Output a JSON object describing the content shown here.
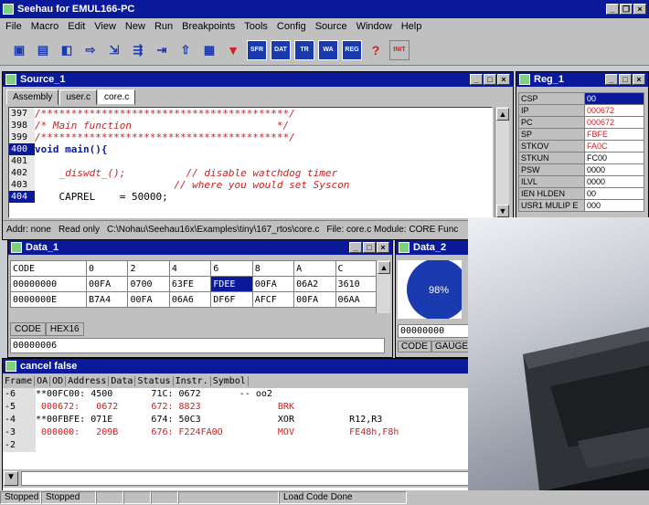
{
  "app": {
    "title": "Seehau for EMUL166-PC",
    "menu": [
      "File",
      "Macro",
      "Edit",
      "View",
      "New",
      "Run",
      "Breakpoints",
      "Tools",
      "Config",
      "Source",
      "Window",
      "Help"
    ]
  },
  "toolbar": {
    "buttons": [
      "open",
      "save",
      "find",
      "GO",
      "step-into",
      "step-over",
      "run-to",
      "reset",
      "break",
      "watch",
      "SFR",
      "DAT",
      "TR",
      "WA",
      "REG",
      "help",
      "INIT"
    ]
  },
  "source": {
    "title": "Source_1",
    "tabs": [
      "Assembly",
      "user.c",
      "core.c"
    ],
    "active_tab": "core.c",
    "lines": [
      {
        "n": "397",
        "code": "/*****************************************/",
        "style": "cmt"
      },
      {
        "n": "398",
        "code": "/* Main function                        */",
        "style": "cmt"
      },
      {
        "n": "399",
        "code": "/*****************************************/",
        "style": "cmt"
      },
      {
        "n": "400",
        "code": "void main(){",
        "style": "kw",
        "hl": true
      },
      {
        "n": "401",
        "code": "",
        "style": ""
      },
      {
        "n": "402",
        "code": "    _diswdt_();          // disable watchdog timer",
        "style": "cmt"
      },
      {
        "n": "403",
        "code": "                       // where you would set Syscon",
        "style": "cmt"
      },
      {
        "n": "404",
        "code": "    CAPREL    = 50000;",
        "style": "",
        "hl": true
      }
    ],
    "status": [
      "Addr: none",
      "Read only",
      "C:\\Nohau\\Seehau16x\\Examples\\tiny\\167_rtos\\core.c",
      "File: core.c Module: CORE Func"
    ]
  },
  "reg": {
    "title": "Reg_1",
    "rows": [
      {
        "name": "CSP",
        "value": "00",
        "sel": true
      },
      {
        "name": "IP",
        "value": "000672",
        "red": true
      },
      {
        "name": "PC",
        "value": "000672",
        "red": true
      },
      {
        "name": "SP",
        "value": "FBFE",
        "red": true
      },
      {
        "name": "STKOV",
        "value": "FA0C",
        "red": true
      },
      {
        "name": "STKUN",
        "value": "FC00"
      },
      {
        "name": "PSW",
        "value": "0000"
      },
      {
        "name": "   ILVL",
        "value": "0000"
      },
      {
        "name": "   IEN HLDEN",
        "value": "00"
      },
      {
        "name": "   USR1 MULIP E",
        "value": "000"
      }
    ]
  },
  "data1": {
    "title": "Data_1",
    "header": [
      "CODE",
      "0",
      "2",
      "4",
      "6",
      "8",
      "A",
      "C"
    ],
    "rows": [
      [
        "00000000",
        "00FA",
        "0700",
        "63FE",
        "FDEE",
        "00FA",
        "06A2",
        "3610"
      ],
      [
        "0000000E",
        "B7A4",
        "00FA",
        "06A6",
        "DF6F",
        "AFCF",
        "00FA",
        "06AA"
      ]
    ],
    "tabs": [
      "CODE",
      "HEX16"
    ],
    "input": "00000006"
  },
  "data2": {
    "title": "Data_2",
    "pie_label": "98%",
    "pie_value": 98,
    "input": "00000000",
    "tabs": [
      "CODE",
      "GAUGE"
    ]
  },
  "cancel": {
    "title": "cancel false",
    "headers": [
      "Frame",
      "OA",
      "OD",
      "Address",
      "Data",
      "Status",
      "Instr.",
      "Symbol"
    ],
    "rows": [
      {
        "frame": "-6",
        "text": "**00FC00: 4500       71C: 0672       -- oo2",
        "red": false
      },
      {
        "frame": "-5",
        "text": " 000672:   0672      672: 8823              BRK",
        "red": true
      },
      {
        "frame": "-4",
        "text": "**00FBFE: 071E       674: 50C3              XOR          R12,R3",
        "red": false
      },
      {
        "frame": "-3",
        "text": " 000000:   209B      676: F224FA0O          MOV          FE48h,F8h",
        "red": true
      },
      {
        "frame": "-2",
        "text": "",
        "red": false
      }
    ]
  },
  "statusbar": [
    "Stopped",
    "Stopped",
    "",
    "",
    "",
    "",
    "Load Code Done"
  ]
}
